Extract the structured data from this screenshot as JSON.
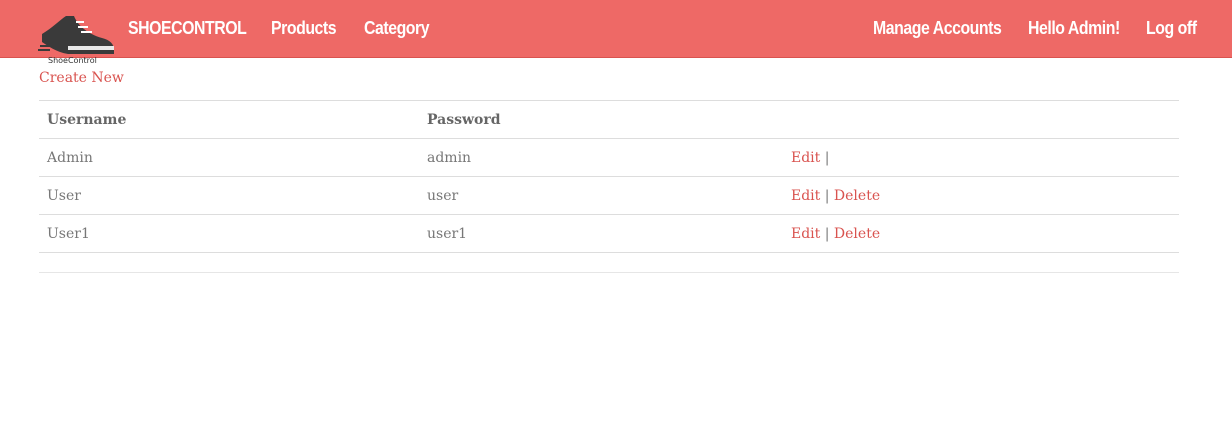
{
  "brand": {
    "logo_text": "ShoeControl",
    "name": "SHOECONTROL"
  },
  "nav": {
    "products": "Products",
    "category": "Category",
    "manage_accounts": "Manage Accounts",
    "hello": "Hello Admin!",
    "logoff": "Log off"
  },
  "colors": {
    "navbar": "#ee6966",
    "link": "#d9534f"
  },
  "page": {
    "create_new": "Create New"
  },
  "table": {
    "headers": {
      "username": "Username",
      "password": "Password"
    },
    "rows": [
      {
        "username": "Admin",
        "password": "admin",
        "edit": "Edit",
        "sep": "|",
        "delete": ""
      },
      {
        "username": "User",
        "password": "user",
        "edit": "Edit",
        "sep": "|",
        "delete": "Delete"
      },
      {
        "username": "User1",
        "password": "user1",
        "edit": "Edit",
        "sep": "|",
        "delete": "Delete"
      }
    ]
  }
}
